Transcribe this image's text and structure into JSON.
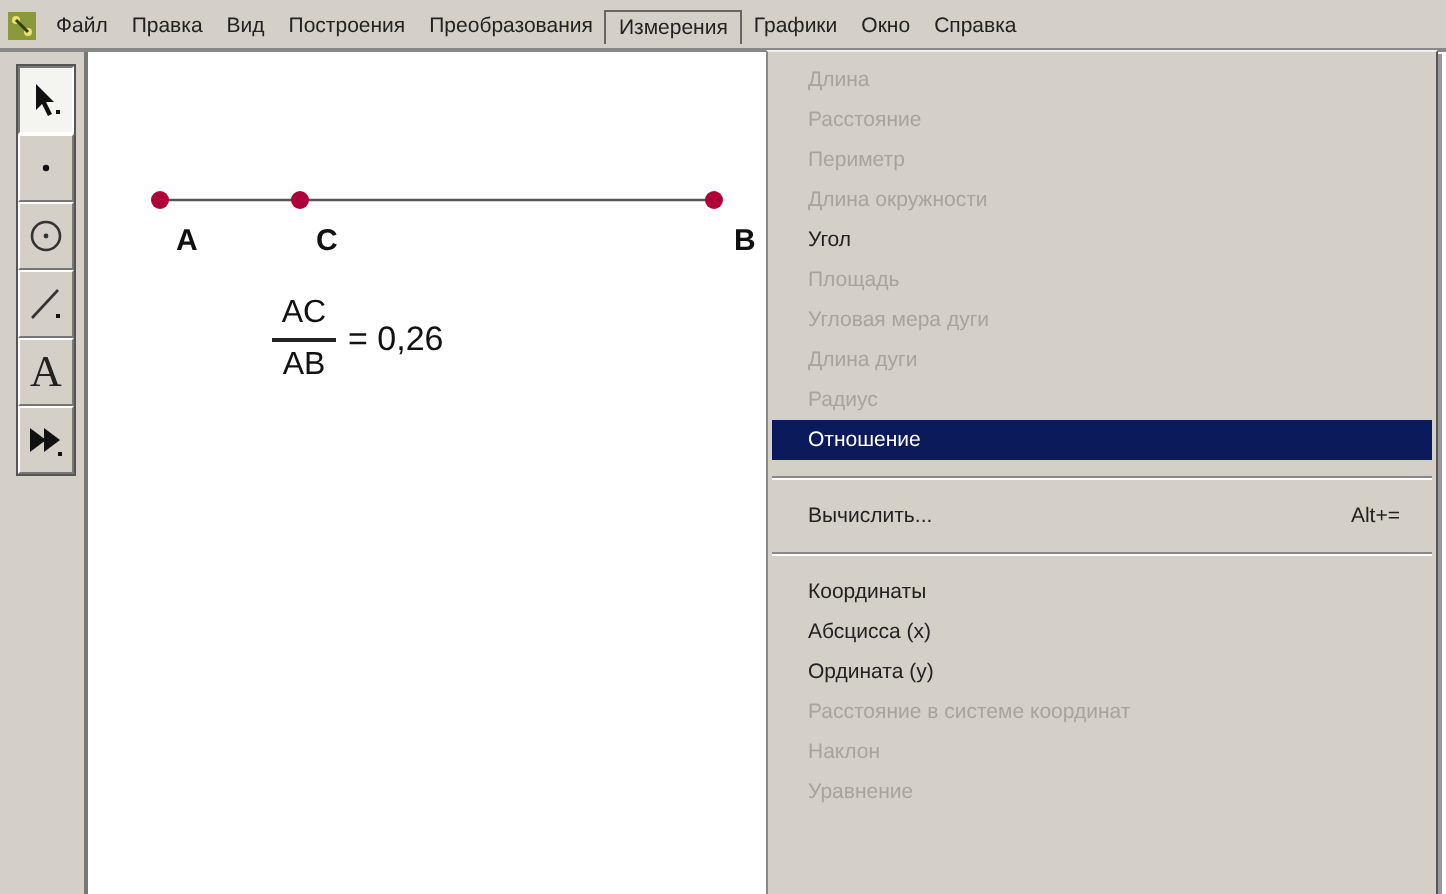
{
  "menubar": [
    {
      "label": "Файл",
      "selected": false
    },
    {
      "label": "Правка",
      "selected": false
    },
    {
      "label": "Вид",
      "selected": false
    },
    {
      "label": "Построения",
      "selected": false
    },
    {
      "label": "Преобразования",
      "selected": false
    },
    {
      "label": "Измерения",
      "selected": true
    },
    {
      "label": "Графики",
      "selected": false
    },
    {
      "label": "Окно",
      "selected": false
    },
    {
      "label": "Справка",
      "selected": false
    }
  ],
  "toolbar": [
    {
      "kind": "arrow",
      "selected": true
    },
    {
      "kind": "point",
      "selected": false
    },
    {
      "kind": "circle",
      "selected": false
    },
    {
      "kind": "line",
      "selected": false
    },
    {
      "kind": "text",
      "label": "A",
      "selected": false
    },
    {
      "kind": "custom",
      "selected": false
    }
  ],
  "canvas": {
    "points": [
      {
        "label": "A"
      },
      {
        "label": "C"
      },
      {
        "label": "B"
      }
    ],
    "measurement": {
      "numerator": "AC",
      "denominator": "AB",
      "value": "= 0,26"
    }
  },
  "menu": {
    "groups": [
      [
        {
          "label": "Длина",
          "disabled": true,
          "selected": false
        },
        {
          "label": "Расстояние",
          "disabled": true,
          "selected": false
        },
        {
          "label": "Периметр",
          "disabled": true,
          "selected": false
        },
        {
          "label": "Длина окружности",
          "disabled": true,
          "selected": false
        },
        {
          "label": "Угол",
          "disabled": false,
          "selected": false
        },
        {
          "label": "Площадь",
          "disabled": true,
          "selected": false
        },
        {
          "label": "Угловая мера дуги",
          "disabled": true,
          "selected": false
        },
        {
          "label": "Длина дуги",
          "disabled": true,
          "selected": false
        },
        {
          "label": "Радиус",
          "disabled": true,
          "selected": false
        },
        {
          "label": "Отношение",
          "disabled": false,
          "selected": true
        }
      ],
      [
        {
          "label": "Вычислить...",
          "shortcut": "Alt+=",
          "disabled": false,
          "selected": false
        }
      ],
      [
        {
          "label": "Координаты",
          "disabled": false,
          "selected": false
        },
        {
          "label": "Абсцисса (x)",
          "disabled": false,
          "selected": false
        },
        {
          "label": "Ордината (y)",
          "disabled": false,
          "selected": false
        },
        {
          "label": "Расстояние в системе координат",
          "disabled": true,
          "selected": false
        },
        {
          "label": "Наклон",
          "disabled": true,
          "selected": false
        },
        {
          "label": "Уравнение",
          "disabled": true,
          "selected": false
        }
      ]
    ]
  }
}
